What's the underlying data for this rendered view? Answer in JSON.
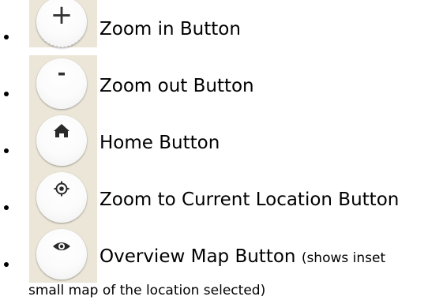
{
  "items": [
    {
      "icon": "plus-icon",
      "glyph": "+",
      "label": "Zoom in Button"
    },
    {
      "icon": "minus-icon",
      "glyph": "-",
      "label": "Zoom out Button"
    },
    {
      "icon": "home-icon",
      "glyph": "",
      "label": "Home Button"
    },
    {
      "icon": "target-icon",
      "glyph": "",
      "label": "Zoom to Current Location Button"
    },
    {
      "icon": "eye-icon",
      "glyph": "",
      "label": "Overview Map Button",
      "note_line1": "(shows inset",
      "note_line2": "small map of the location selected)"
    }
  ]
}
